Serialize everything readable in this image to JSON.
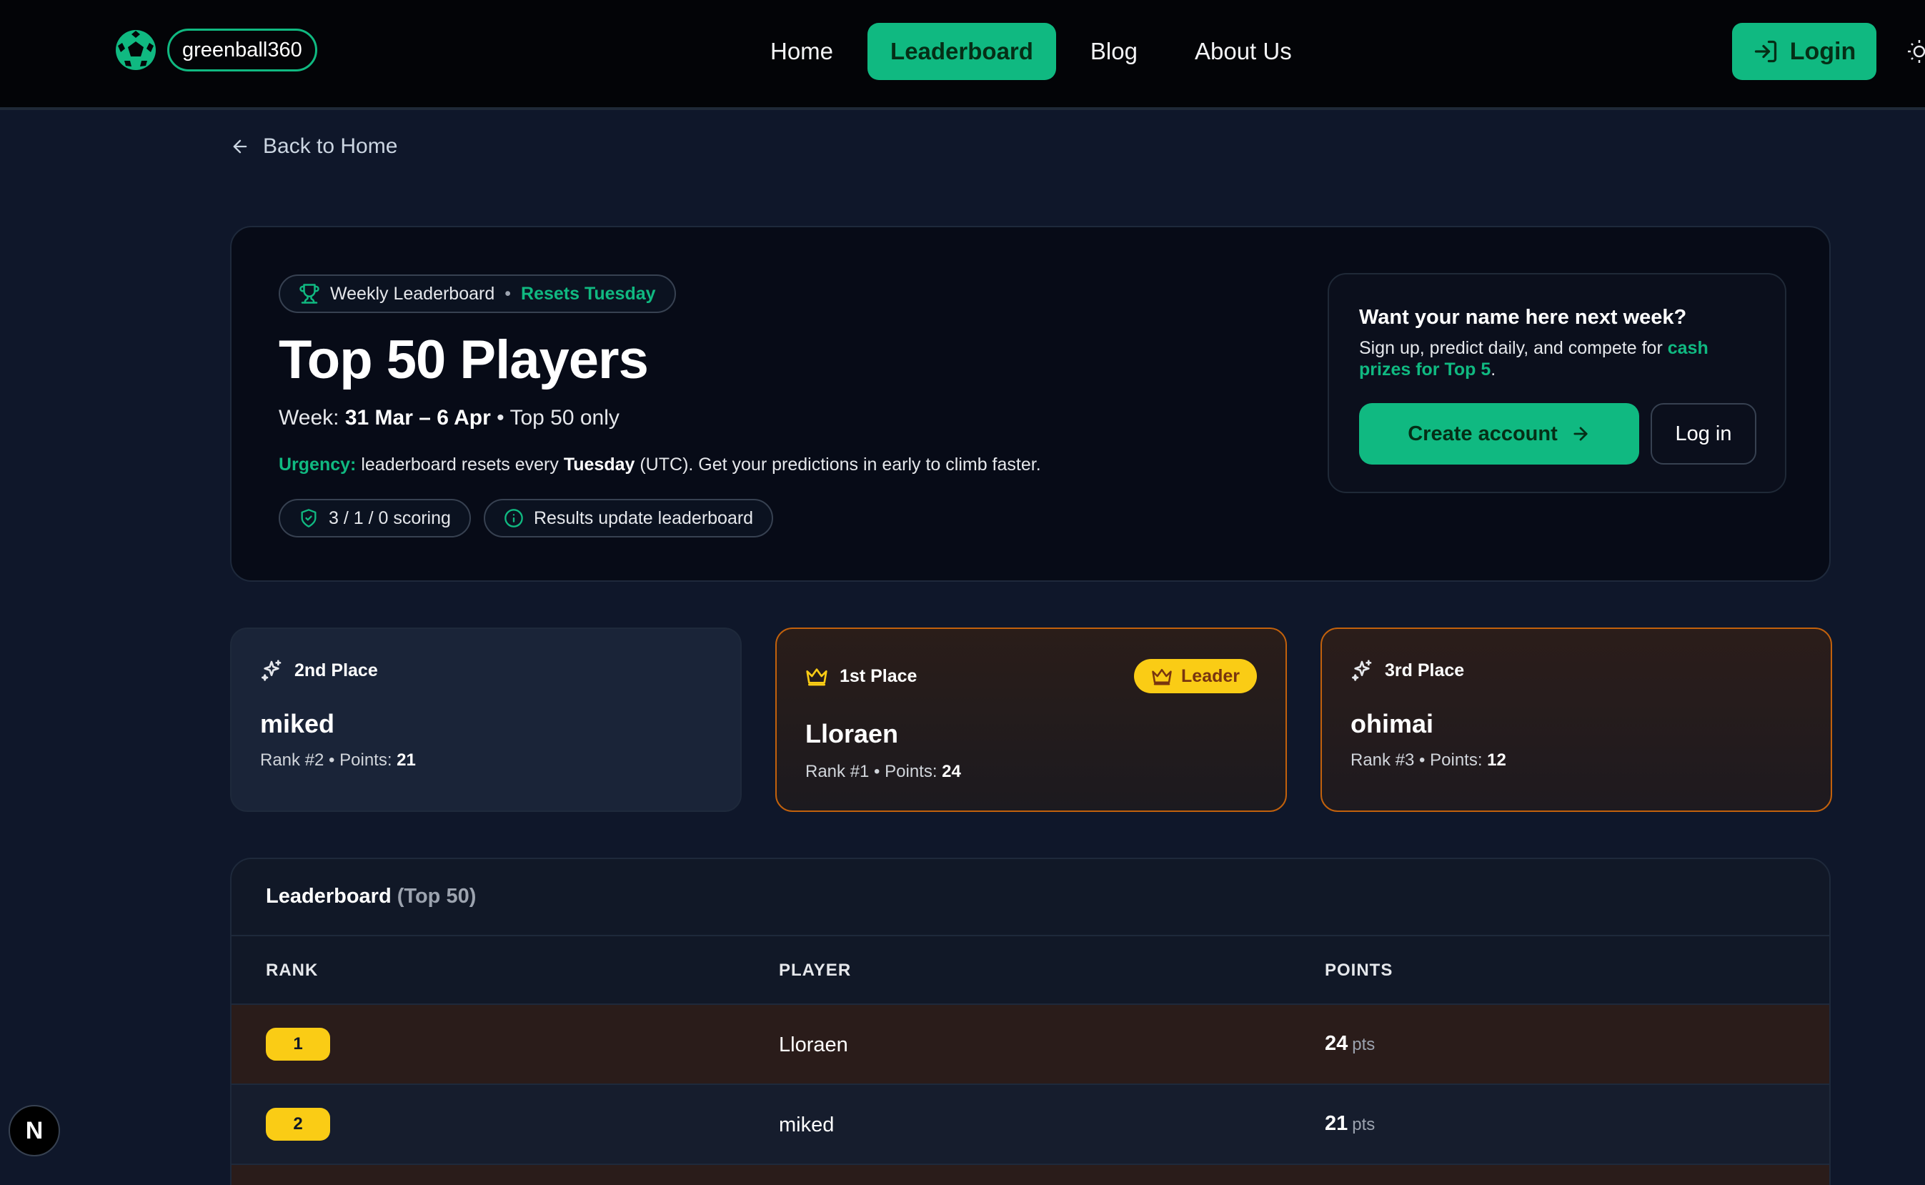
{
  "nav": {
    "brand": "greenball360",
    "links": [
      "Home",
      "Leaderboard",
      "Blog",
      "About Us"
    ],
    "active": "Leaderboard",
    "login_label": "Login"
  },
  "back_label": "Back to Home",
  "hero": {
    "pill_label": "Weekly Leaderboard",
    "pill_accent": "Resets Tuesday",
    "title": "Top 50 Players",
    "week_prefix": "Week:",
    "week_range": "31 Mar – 6 Apr",
    "week_suffix": "• Top 50 only",
    "urgency_label": "Urgency:",
    "urgency_text_1": "leaderboard resets every",
    "urgency_day": "Tuesday",
    "urgency_text_2": "(UTC). Get your predictions in early to climb faster.",
    "chip_scoring": "3 / 1 / 0 scoring",
    "chip_results": "Results update leaderboard"
  },
  "cta": {
    "title": "Want your name here next week?",
    "text": "Sign up, predict daily, and compete for",
    "accent": "cash prizes for Top 5",
    "period": ".",
    "create_label": "Create account",
    "login_label": "Log in"
  },
  "podium": {
    "second": {
      "place": "2nd Place",
      "name": "miked",
      "rank_label": "Rank #2 • Points:",
      "points": "21"
    },
    "first": {
      "place": "1st Place",
      "badge": "Leader",
      "name": "Lloraen",
      "rank_label": "Rank #1 • Points:",
      "points": "24"
    },
    "third": {
      "place": "3rd Place",
      "name": "ohimai",
      "rank_label": "Rank #3 • Points:",
      "points": "12"
    }
  },
  "table": {
    "title": "Leaderboard",
    "subtitle": "(Top 50)",
    "headers": {
      "rank": "RANK",
      "player": "PLAYER",
      "points": "POINTS"
    },
    "unit": "pts",
    "rows": [
      {
        "rank": "1",
        "player": "Lloraen",
        "points": "24"
      },
      {
        "rank": "2",
        "player": "miked",
        "points": "21"
      }
    ]
  },
  "next_badge": "N",
  "colors": {
    "accent": "#10b981",
    "gold": "#facc15",
    "bg": "#0f172a"
  }
}
